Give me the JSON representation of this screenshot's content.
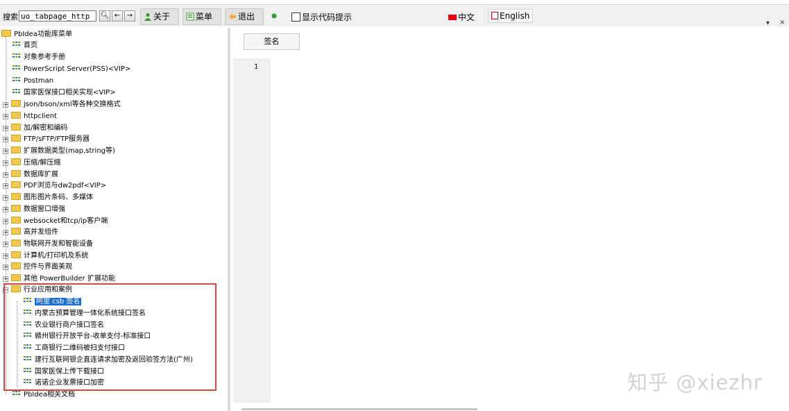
{
  "toolbar": {
    "search_label": "搜索",
    "search_value": "uo_tabpage_http",
    "about_label": "关于",
    "menu_label": "菜单",
    "exit_label": "退出",
    "show_code_hint_label": "显示代码提示",
    "lang_cn": "中文",
    "lang_en": "English",
    "dropdown_glyph": "▾",
    "close_glyph": "×"
  },
  "tree": {
    "root": "PbIdea功能库菜单",
    "items": [
      "首页",
      "对象参考手册",
      "PowerScript Server(PSS)<VIP>",
      "Postman",
      "国家医保接口相关实现<VIP>"
    ],
    "folders": [
      "json/bson/xml等各种交换格式",
      "httpclient",
      "加/解密和编码",
      "FTP/sFTP/FTP服务器",
      "扩展数据类型(map,string等)",
      "压缩/解压缩",
      "数据库扩展",
      "PDF浏览与dw2pdf<VIP>",
      "图形图片条码、多媒体",
      "数据窗口增强",
      "websocket和tcp/ip客户端",
      "高并发组件",
      "物联网开发和智能设备",
      "计算机/打印机及系统",
      "控件与界面美观",
      "其他 PowerBuilder 扩展功能"
    ],
    "open_folder": "行业应用和案例",
    "open_children": [
      "阿里 csb 签名",
      "内蒙古预算管理一体化系统接口签名",
      "农业银行商户接口签名",
      "赣州银行开放平台-收单支付-标准接口",
      "工商银行二维码被扫支付接口",
      "建行互联网银企直连请求加密及返回验签方法(广州)",
      "国家医保上传下载接口",
      "诺诺企业发票接口加密"
    ],
    "last_item": "PbIdea相关文档"
  },
  "editor": {
    "tab_label": "签名",
    "line_number": "1"
  },
  "watermark": "知乎 @xiezhr"
}
